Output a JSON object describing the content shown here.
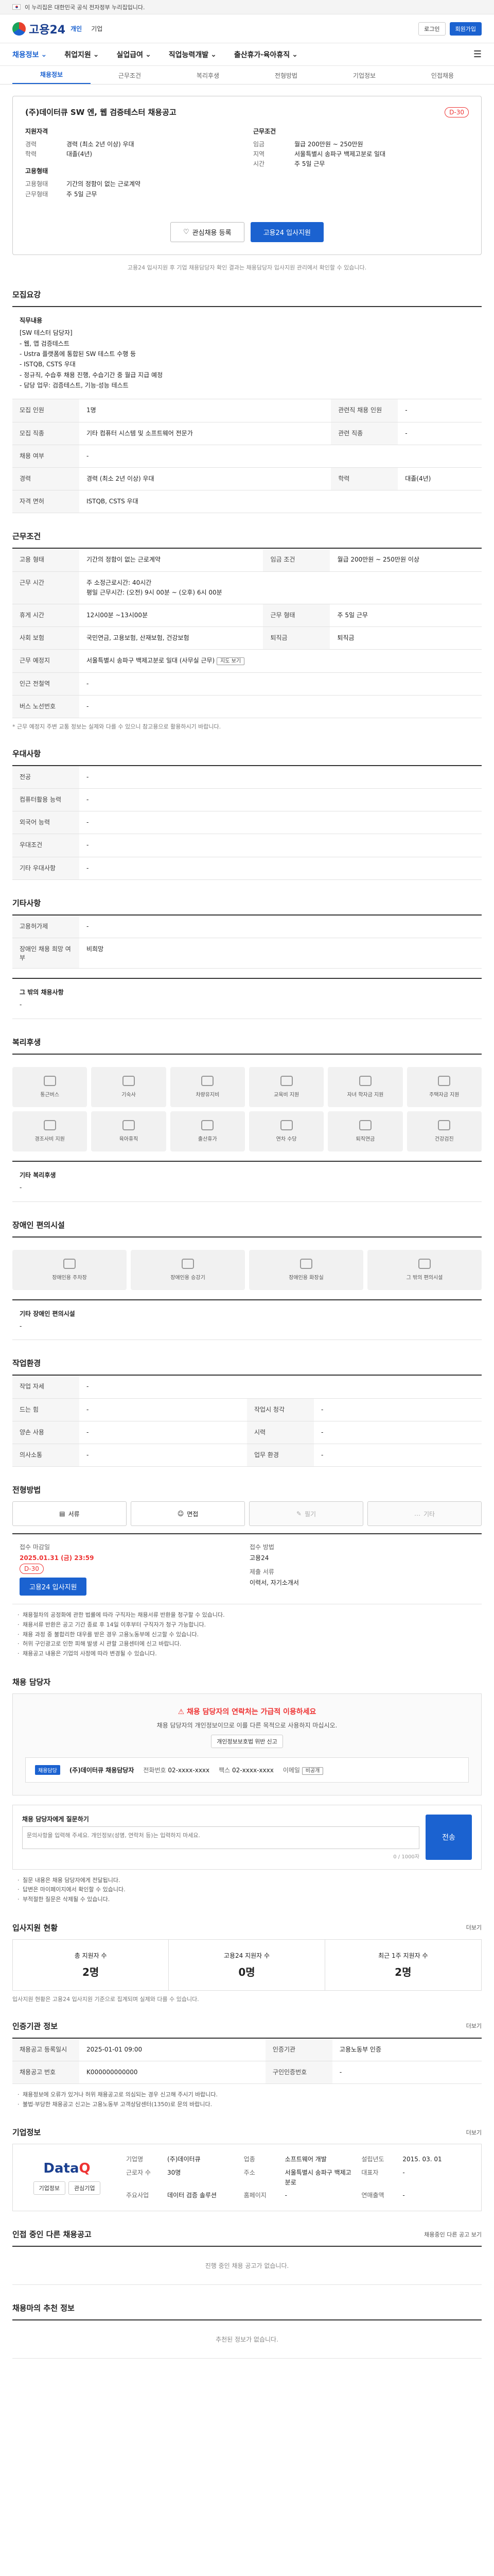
{
  "gov_banner": "이 누리집은 대한민국 공식 전자정부 누리집입니다.",
  "header": {
    "logo": "고용24",
    "top_links": [
      "개인",
      "기업"
    ],
    "right_links": [
      "로그인",
      "회원가입"
    ],
    "gnb": [
      "채용정보",
      "취업지원",
      "실업급여",
      "직업능력개발",
      "출산휴가·육아휴직"
    ],
    "subtabs": [
      "채용정보",
      "근무조건",
      "복리후생",
      "전형방법",
      "기업정보",
      "인접채용"
    ]
  },
  "job": {
    "company": "(주)데이터큐",
    "title": "(주)데이터큐 SW 엔, 웹 검증테스터 채용공고",
    "dday": "D-30",
    "qual_title": "지원자격",
    "qual": [
      {
        "k": "경력",
        "v": "경력 (최소 2년 이상) 우대"
      },
      {
        "k": "학력",
        "v": "대졸(4년)"
      }
    ],
    "work_title": "근무조건",
    "work": [
      {
        "k": "임금",
        "v": "월급 200만원 ~ 250만원"
      },
      {
        "k": "지역",
        "v": "서울특별시 송파구 백제고분로 일대"
      },
      {
        "k": "시간",
        "v": "주 5일 근무"
      }
    ],
    "emp_title": "고용형태",
    "emp": [
      {
        "k": "고용형태",
        "v": "기간의 정함이 없는 근로계약"
      },
      {
        "k": "근무형태",
        "v": "주 5일 근무"
      }
    ],
    "btn_save": "관심채용 등록",
    "btn_apply": "고용24 입사지원",
    "note": "고용24 입사지원 후 기업 채용담당자 확인 결과는 채용담당자 입사지원 관리에서 확인할 수 있습니다."
  },
  "recruit": {
    "title": "모집요강",
    "job_title": "직무내용",
    "job_content": "[SW 테스터 담당자]\n- 웹, 앱 검증테스트\n- Ustra 플랫폼에 통합된 SW 테스트 수행 등\n- ISTQB, CSTS 우대\n- 정규직, 수습후 채용 진행, 수습기간 중 월급 지급 예정\n- 담당 업무: 검증테스트, 기능·성능 테스트",
    "rows": [
      {
        "k": "모집 인원",
        "v": "1명",
        "k2": "관련직 채용 인원",
        "v2": "-"
      },
      {
        "k": "모집 직종",
        "v": "기타 컴퓨터 시스템 및 소프트웨어 전문가",
        "k2": "관련 직종",
        "v2": "-"
      },
      {
        "k": "채용 여부",
        "v": "-",
        "k2": "",
        "v2": ""
      },
      {
        "k": "경력",
        "v": "경력 (최소 2년 이상) 우대",
        "k2": "학력",
        "v2": "대졸(4년)"
      },
      {
        "k": "자격 면허",
        "v": "ISTQB, CSTS 우대",
        "k2": "",
        "v2": ""
      }
    ]
  },
  "conditions": {
    "title": "근무조건",
    "rows": [
      {
        "k": "고용 형태",
        "v": "기간의 정함이 없는 근로계약",
        "k2": "임금 조건",
        "v2": "월급 200만원 ~ 250만원 이상"
      },
      {
        "k": "근무 시간",
        "v": "주 소정근로시간: 40시간\n평일 근무시간: (오전) 9시 00분 ~ (오후) 6시 00분",
        "k2": "",
        "v2": ""
      },
      {
        "k": "휴게 시간",
        "v": "12시00분 ~13시00분",
        "k2": "근무 형태",
        "v2": "주 5일 근무"
      },
      {
        "k": "사회 보험",
        "v": "국민연금, 고용보험, 산재보험, 건강보험",
        "k2": "퇴직금",
        "v2": "퇴직금"
      },
      {
        "k": "근무 예정지",
        "v": "서울특별시 송파구 백제고분로 일대 (사무실 근무)",
        "k2": "",
        "v2": ""
      },
      {
        "k": "인근 전철역",
        "v": "-",
        "k2": "",
        "v2": ""
      },
      {
        "k": "버스 노선번호",
        "v": "-",
        "k2": "",
        "v2": ""
      }
    ],
    "note": "* 근무 예정지 주변 교통 정보는 실제와 다를 수 있으니 참고용으로 활용하시기 바랍니다."
  },
  "prefer": {
    "title": "우대사항",
    "rows": [
      {
        "k": "전공",
        "v": "-"
      },
      {
        "k": "컴퓨터활용 능력",
        "v": "-"
      },
      {
        "k": "외국어 능력",
        "v": "-"
      },
      {
        "k": "우대조건",
        "v": "-"
      },
      {
        "k": "기타 우대사항",
        "v": "-"
      }
    ]
  },
  "etc": {
    "title": "기타사항",
    "rows": [
      {
        "k": "고용허가제",
        "v": "-"
      },
      {
        "k": "장애인 채용 희망 여부",
        "v": "비희망"
      }
    ],
    "box_head": "그 밖의 채용사항",
    "box_text": "-"
  },
  "welfare": {
    "title": "복리후생",
    "items": [
      "통근버스",
      "기숙사",
      "차량유지비",
      "교육비 지원",
      "자녀 학자금 지원",
      "주택자금 지원",
      "경조사비 지원",
      "육아휴직",
      "출산휴가",
      "연차 수당",
      "퇴직연금",
      "건강검진"
    ],
    "box_head": "기타 복리후생",
    "box_text": "-"
  },
  "disability": {
    "title": "장애인 편의시설",
    "items": [
      "장애인용 주차장",
      "장애인용 승강기",
      "장애인용 화장실",
      "그 밖의 편의시설"
    ],
    "box_head": "기타 장애인 편의시설",
    "box_text": "-"
  },
  "environment": {
    "title": "작업환경",
    "rows": [
      {
        "k": "작업 자세",
        "v": "-",
        "k2": "",
        "v2": ""
      },
      {
        "k": "드는 힘",
        "v": "-",
        "k2": "작업시 청각",
        "v2": "-"
      },
      {
        "k": "양손 사용",
        "v": "-",
        "k2": "시력",
        "v2": "-"
      },
      {
        "k": "의사소통",
        "v": "-",
        "k2": "업무 환경",
        "v2": "-"
      }
    ]
  },
  "process": {
    "title": "전형방법",
    "methods": [
      "서류",
      "면접",
      "필기",
      "기타"
    ],
    "deadline_label": "접수 마감일",
    "deadline": "2025.01.31 (금) 23:59",
    "dday": "D-30",
    "apply_method_label": "접수 방법",
    "apply_method": "고용24",
    "docs_label": "제출 서류",
    "docs": "이력서, 자기소개서",
    "apply_btn": "고용24 입사지원",
    "notices": [
      "채용절차의 공정화에 관한 법률에 따라 구직자는 채용서류 반환을 청구할 수 있습니다.",
      "채용서류 반환은 공고 기간 종료 후 14일 이후부터 구직자가 청구 가능합니다.",
      "채용 과정 중 불합리한 대우를 받은 경우 고용노동부에 신고할 수 있습니다.",
      "허위 구인광고로 인한 피해 발생 시 관할 고용센터에 신고 바랍니다.",
      "채용공고 내용은 기업의 사정에 따라 변경될 수 있습니다."
    ]
  },
  "manager": {
    "title": "채용 담당자",
    "warn": "채용 담당자의 연락처는 가급적 이용하세요",
    "desc": "채용 담당자의 개인정보이므로 이를 다른 목적으로 사용하지 마십시오.",
    "sub_btn": "개인정보보호법 위반 신고",
    "badge": "채용담당",
    "name": "(주)데이터큐 채용담당자",
    "phone_label": "전화번호",
    "phone": "02-xxxx-xxxx",
    "fax_label": "팩스",
    "fax": "02-xxxx-xxxx",
    "email_label": "이메일",
    "email": "비공개",
    "inquiry_label": "채용 담당자에게 질문하기",
    "inquiry_placeholder": "문의사항을 입력해 주세요. 개인정보(성명, 연락처 등)는 입력하지 마세요.",
    "inquiry_count": "0 / 1000자",
    "send": "전송",
    "inquiry_notes": [
      "질문 내용은 채용 담당자에게 전달됩니다.",
      "답변은 마이페이지에서 확인할 수 있습니다.",
      "부적절한 질문은 삭제될 수 있습니다."
    ]
  },
  "applicants": {
    "title": "입사지원 현황",
    "more": "더보기",
    "stats": [
      {
        "label": "총 지원자 수",
        "value": "2명"
      },
      {
        "label": "고용24 지원자 수",
        "value": "0명"
      },
      {
        "label": "최근 1주 지원자 수",
        "value": "2명"
      }
    ],
    "note": "입사지원 현황은 고용24 입사지원 기준으로 집계되며 실제와 다를 수 있습니다."
  },
  "info": {
    "title": "인증기관 정보",
    "more": "더보기",
    "rows": [
      {
        "k": "채용공고 등록일시",
        "v": "2025-01-01 09:00",
        "k2": "인증기관",
        "v2": "고용노동부 인증"
      },
      {
        "k": "채용공고 번호",
        "v": "K000000000000",
        "k2": "구인인증번호",
        "v2": "-"
      }
    ],
    "notes": [
      "채용정보에 오류가 있거나 허위 채용공고로 의심되는 경우 신고해 주시기 바랍니다.",
      "불법·부당한 채용공고 신고는 고용노동부 고객상담센터(1350)로 문의 바랍니다."
    ]
  },
  "company": {
    "title": "기업정보",
    "more": "더보기",
    "logo_a": "Data",
    "logo_b": "Q",
    "logo_btn1": "기업정보",
    "logo_btn2": "관심기업",
    "fields": [
      {
        "k": "기업명",
        "v": "(주)데이터큐"
      },
      {
        "k": "업종",
        "v": "소프트웨어 개발"
      },
      {
        "k": "설립년도",
        "v": "2015. 03. 01"
      },
      {
        "k": "근로자 수",
        "v": "30명"
      },
      {
        "k": "주소",
        "v": "서울특별시 송파구 백제고분로"
      },
      {
        "k": "대표자",
        "v": "-"
      },
      {
        "k": "주요사업",
        "v": "데이터 검증 솔루션"
      },
      {
        "k": "홈페이지",
        "v": "-"
      },
      {
        "k": "연매출액",
        "v": "-"
      }
    ]
  },
  "other_jobs": {
    "title": "인접 중인 다른 채용공고",
    "more": "채용중인 다른 공고 보기",
    "empty": "진행 중인 채용 공고가 없습니다."
  },
  "recommend": {
    "title": "채용마의 추천 정보",
    "empty": "추천된 정보가 없습니다."
  }
}
